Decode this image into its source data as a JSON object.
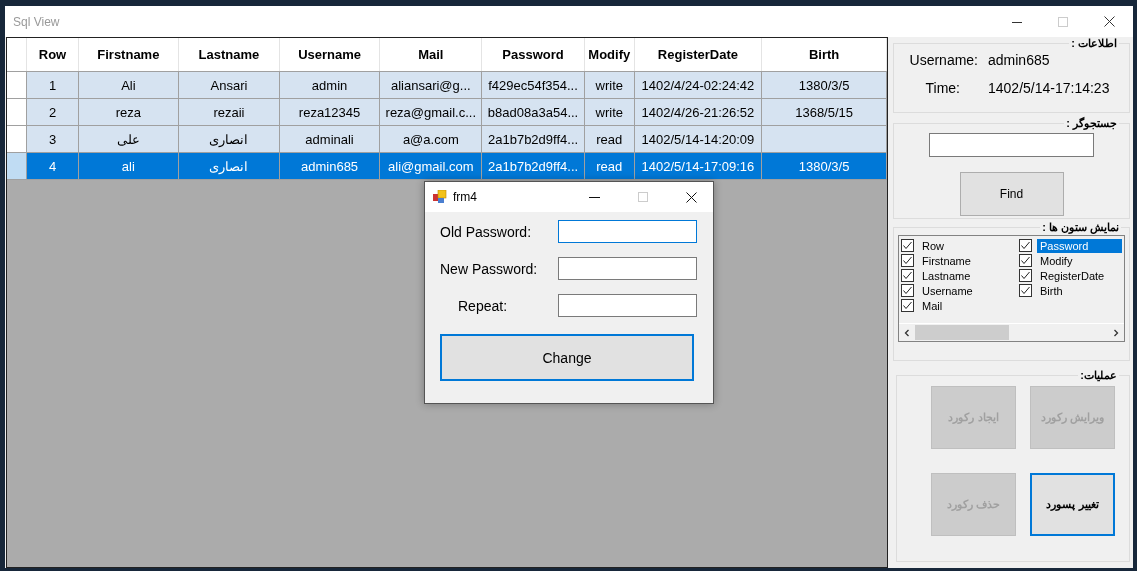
{
  "window": {
    "title": "Sql View"
  },
  "grid": {
    "columns": [
      "Row",
      "Firstname",
      "Lastname",
      "Username",
      "Mail",
      "Password",
      "Modify",
      "RegisterDate",
      "Birth"
    ],
    "rows": [
      {
        "selected": false,
        "cells": [
          "1",
          "Ali",
          "Ansari",
          "admin",
          "aliansari@g...",
          "f429ec54f354...",
          "write",
          "1402/4/24-02:24:42",
          "1380/3/5"
        ]
      },
      {
        "selected": false,
        "cells": [
          "2",
          "reza",
          "rezaii",
          "reza12345",
          "reza@gmail.c...",
          "b8ad08a3a54...",
          "write",
          "1402/4/26-21:26:52",
          "1368/5/15"
        ]
      },
      {
        "selected": false,
        "cells": [
          "3",
          "علی",
          "انصاری",
          "adminali",
          "a@a.com",
          "2a1b7b2d9ff4...",
          "read",
          "1402/5/14-14:20:09",
          null
        ]
      },
      {
        "selected": true,
        "cells": [
          "4",
          "ali",
          "انصاری",
          "admin685",
          "ali@gmail.com",
          "2a1b7b2d9ff4...",
          "read",
          "1402/5/14-17:09:16",
          "1380/3/5"
        ]
      }
    ]
  },
  "info": {
    "title": "اطلاعات :",
    "fields": [
      {
        "label": "Username:",
        "value": "admin685"
      },
      {
        "label": "Time:",
        "value": "1402/5/14-17:14:23"
      }
    ]
  },
  "search": {
    "title": "جستجوگر :",
    "button": "Find"
  },
  "columns_panel": {
    "title": "نمایش ستون ها :",
    "items": [
      {
        "label": "Row",
        "checked": true,
        "selected": false
      },
      {
        "label": "Firstname",
        "checked": true,
        "selected": false
      },
      {
        "label": "Lastname",
        "checked": true,
        "selected": false
      },
      {
        "label": "Username",
        "checked": true,
        "selected": false
      },
      {
        "label": "Mail",
        "checked": true,
        "selected": false
      },
      {
        "label": "Password",
        "checked": true,
        "selected": true
      },
      {
        "label": "Modify",
        "checked": true,
        "selected": false
      },
      {
        "label": "RegisterDate",
        "checked": true,
        "selected": false
      },
      {
        "label": "Birth",
        "checked": true,
        "selected": false
      }
    ]
  },
  "operations": {
    "title": "عملیات:",
    "buttons": [
      {
        "label": "ایجاد رکورد",
        "disabled": true,
        "focused": false
      },
      {
        "label": "ویرایش رکورد",
        "disabled": true,
        "focused": false
      },
      {
        "label": "حذف رکورد",
        "disabled": true,
        "focused": false
      },
      {
        "label": "تغییر پسورد",
        "disabled": false,
        "focused": true
      }
    ]
  },
  "dialog": {
    "title": "frm4",
    "fields": [
      {
        "label": "Old Password:",
        "focused": true
      },
      {
        "label": "New Password:",
        "focused": false
      },
      {
        "label": "Repeat:",
        "focused": false
      }
    ],
    "button": {
      "label": "Change",
      "focused": true
    }
  }
}
